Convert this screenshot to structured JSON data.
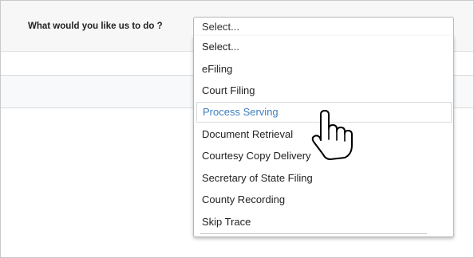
{
  "form": {
    "question_label": "What would you like us to do ?",
    "select": {
      "value": "Select...",
      "options": [
        "Select...",
        "eFiling",
        "Court Filing",
        "Process Serving",
        "Document Retrieval",
        "Courtesy Copy Delivery",
        "Secretary of State Filing",
        "County Recording",
        "Skip Trace"
      ],
      "highlighted_option": "Process Serving"
    }
  },
  "colors": {
    "highlight_text": "#3d7fbf",
    "option_text": "#222222",
    "border": "#b5b5b5"
  },
  "cursor": {
    "icon": "hand-pointer-icon"
  }
}
